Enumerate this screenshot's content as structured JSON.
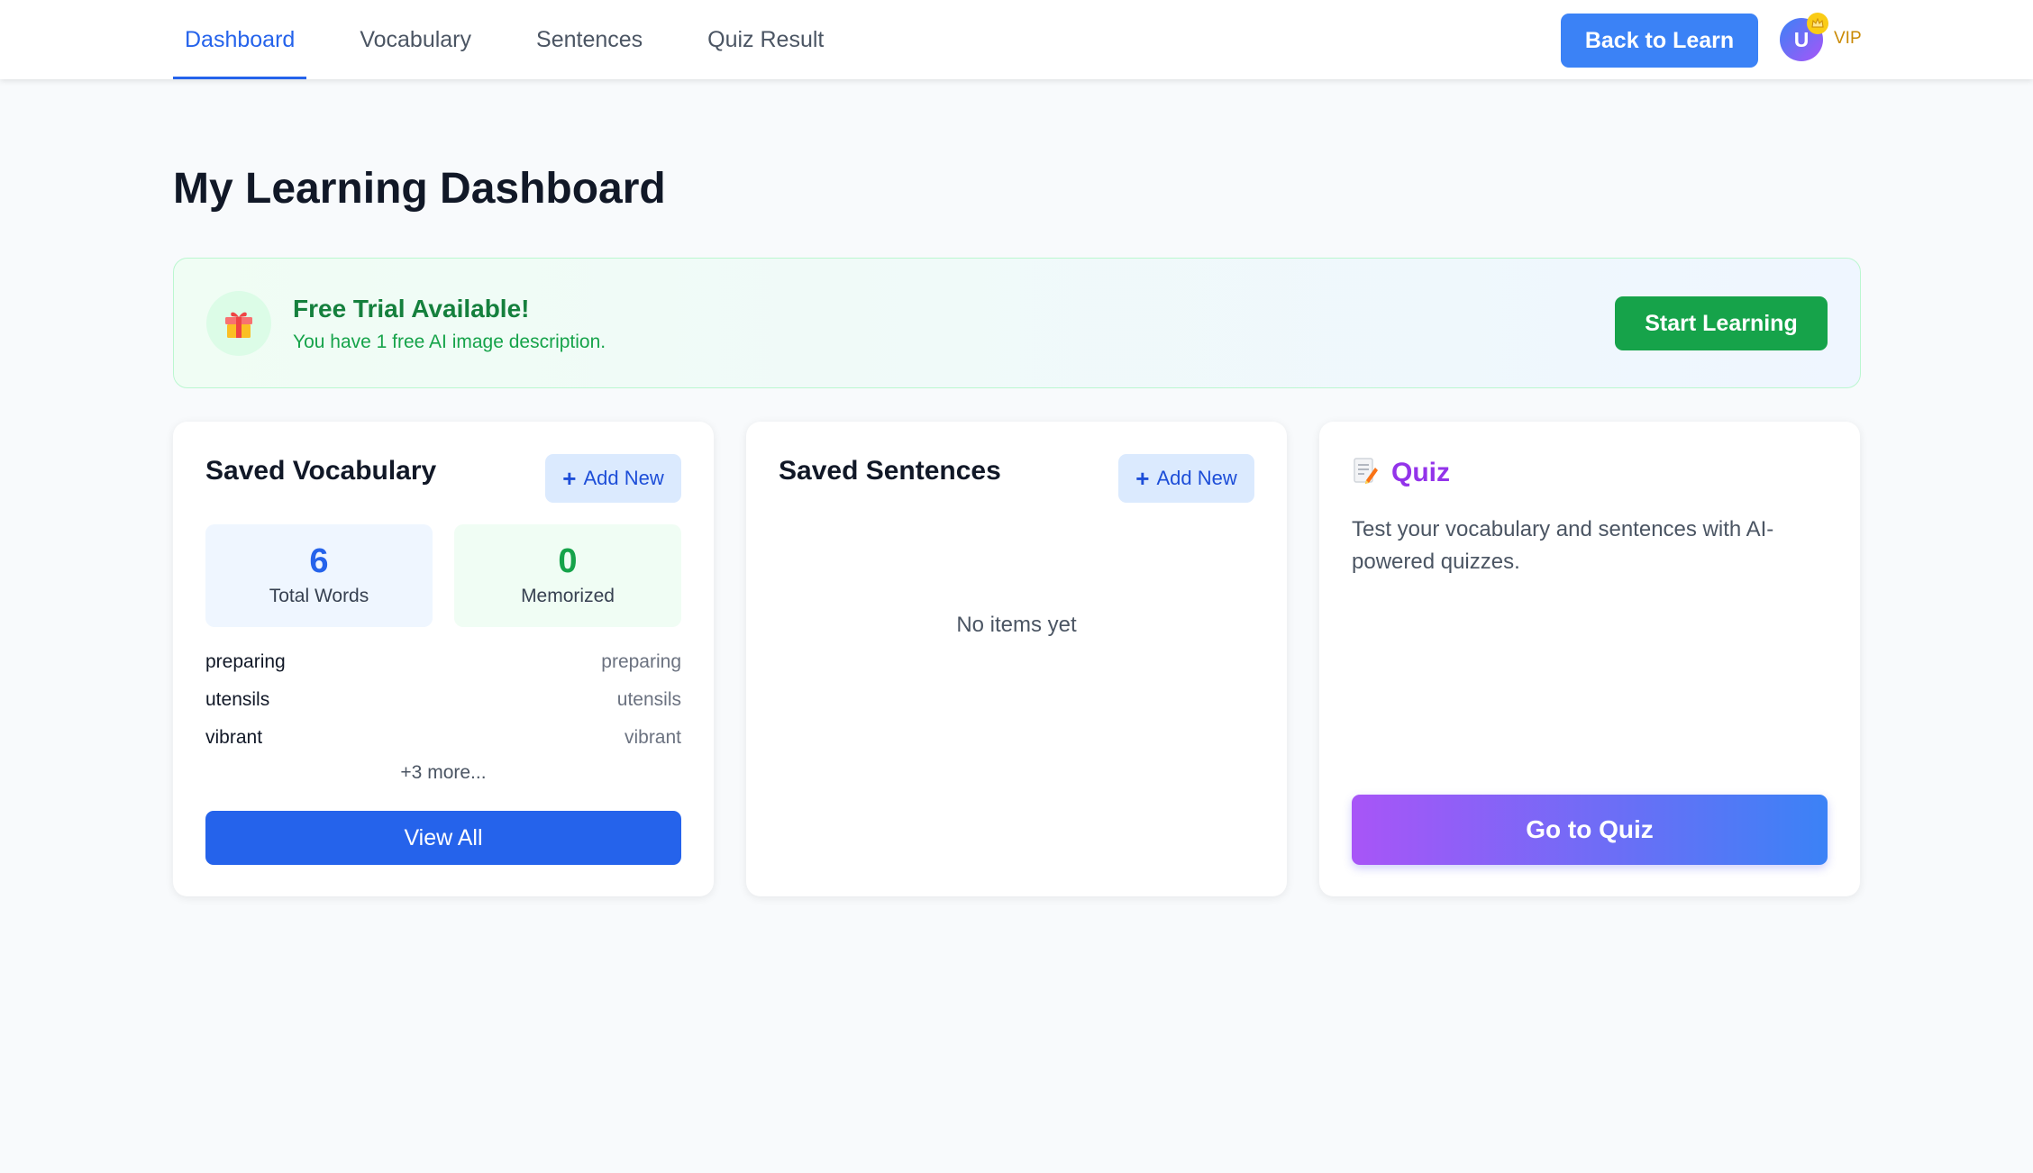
{
  "nav": {
    "tabs": [
      {
        "label": "Dashboard",
        "active": true
      },
      {
        "label": "Vocabulary",
        "active": false
      },
      {
        "label": "Sentences",
        "active": false
      },
      {
        "label": "Quiz Result",
        "active": false
      }
    ],
    "back_label": "Back to Learn",
    "avatar_initial": "U",
    "vip_label": "VIP"
  },
  "page_title": "My Learning Dashboard",
  "trial": {
    "title": "Free Trial Available!",
    "text": "You have 1 free AI image description.",
    "button": "Start Learning",
    "icon": "gift-icon"
  },
  "vocabulary": {
    "title": "Saved Vocabulary",
    "add_label": "Add New",
    "total_count": "6",
    "total_label": "Total Words",
    "memorized_count": "0",
    "memorized_label": "Memorized",
    "words": [
      {
        "word": "preparing",
        "translation": "preparing"
      },
      {
        "word": "utensils",
        "translation": "utensils"
      },
      {
        "word": "vibrant",
        "translation": "vibrant"
      }
    ],
    "more_label": "+3 more...",
    "view_all_label": "View All"
  },
  "sentences": {
    "title": "Saved Sentences",
    "add_label": "Add New",
    "empty_text": "No items yet"
  },
  "quiz": {
    "title": "Quiz",
    "icon": "memo-icon",
    "description": "Test your vocabulary and sentences with AI-powered quizzes.",
    "button": "Go to Quiz"
  },
  "colors": {
    "primary": "#2563eb",
    "accent_blue": "#3b82f6",
    "success": "#16a34a",
    "quiz_purple": "#9333ea",
    "vip_gold": "#ca8a04"
  }
}
